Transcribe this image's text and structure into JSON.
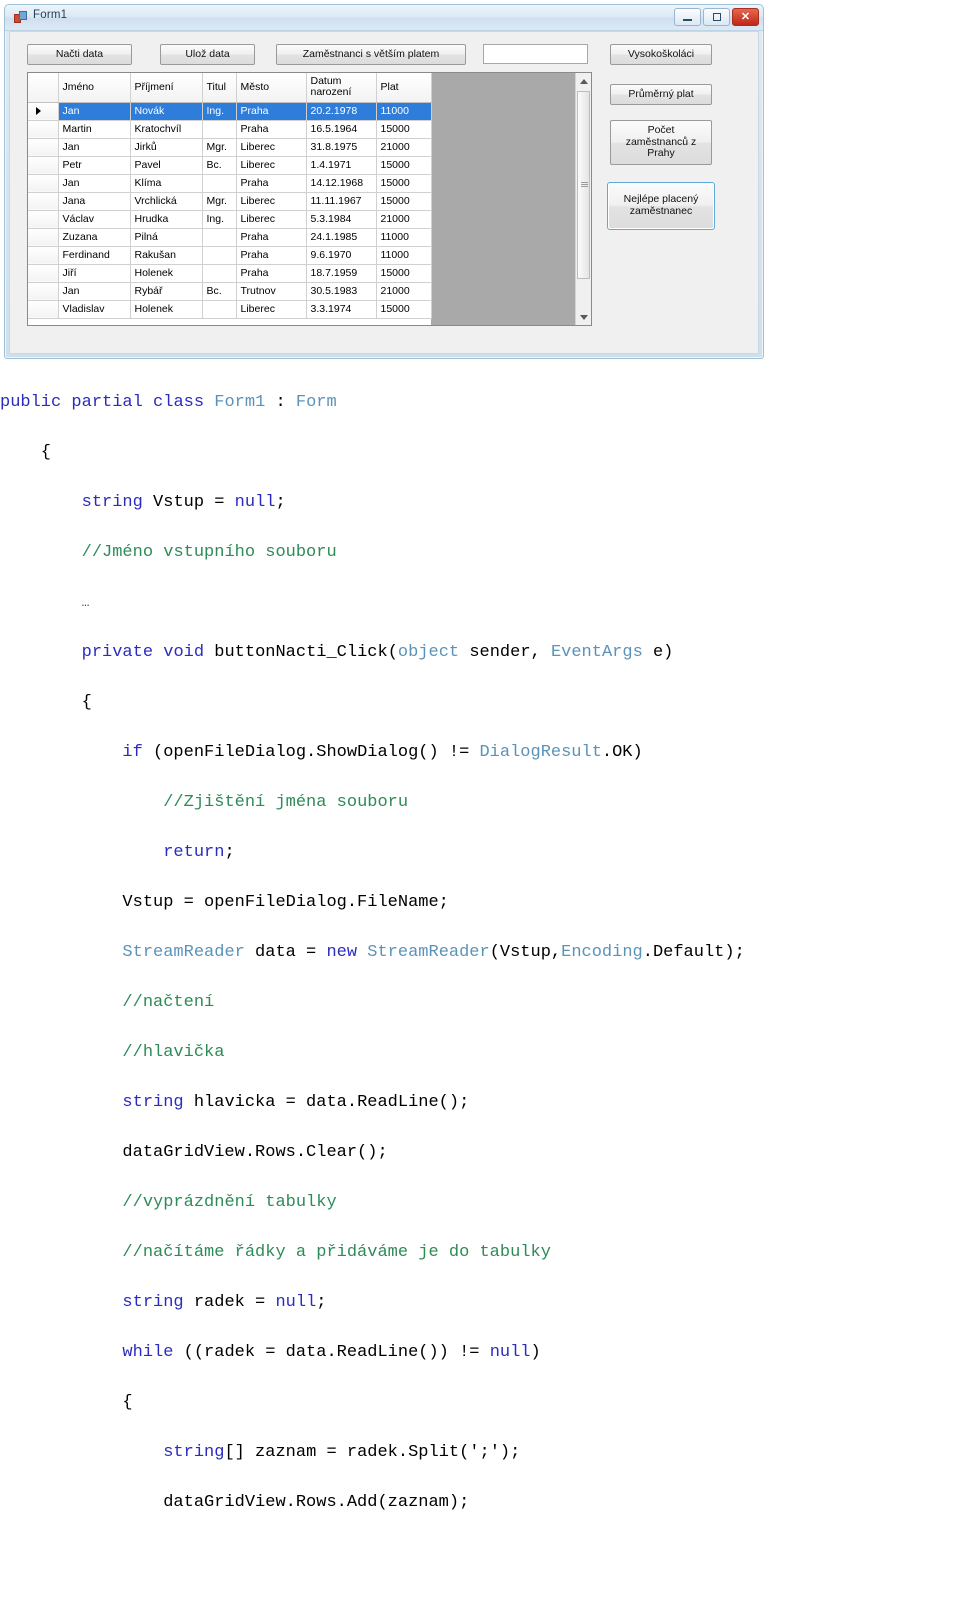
{
  "window": {
    "title": "Form1",
    "icon": "winforms-app-icon",
    "controls": {
      "minimize": "minimize",
      "maximize": "maximize",
      "close": "close"
    }
  },
  "toolbar": {
    "nacti_label": "Načti data",
    "uloz_label": "Ulož data",
    "zamestnanci_label": "Zaměstnanci s větším platem",
    "input_value": "",
    "input_placeholder": ""
  },
  "side_buttons": {
    "vysokoskolaci": "Vysokoškoláci",
    "prumerny_plat": "Průměrný plat",
    "pocet_line1": "Počet",
    "pocet_line2": "zaměstnanců z",
    "pocet_line3": "Prahy",
    "nejlepe_line1": "Nejlépe placený",
    "nejlepe_line2": "zaměstnanec"
  },
  "grid": {
    "columns": [
      "Jméno",
      "Příjmení",
      "Titul",
      "Město",
      "Datum narození",
      "Plat"
    ],
    "column_datum_line1": "Datum",
    "column_datum_line2": "narození",
    "selected_row_index": 0,
    "rows": [
      {
        "jmeno": "Jan",
        "prijmeni": "Novák",
        "titul": "Ing.",
        "mesto": "Praha",
        "datum": "20.2.1978",
        "plat": "11000"
      },
      {
        "jmeno": "Martin",
        "prijmeni": "Kratochvíl",
        "titul": "",
        "mesto": "Praha",
        "datum": "16.5.1964",
        "plat": "15000"
      },
      {
        "jmeno": "Jan",
        "prijmeni": "Jirků",
        "titul": "Mgr.",
        "mesto": "Liberec",
        "datum": "31.8.1975",
        "plat": "21000"
      },
      {
        "jmeno": "Petr",
        "prijmeni": "Pavel",
        "titul": "Bc.",
        "mesto": "Liberec",
        "datum": "1.4.1971",
        "plat": "15000"
      },
      {
        "jmeno": "Jan",
        "prijmeni": "Klíma",
        "titul": "",
        "mesto": "Praha",
        "datum": "14.12.1968",
        "plat": "15000"
      },
      {
        "jmeno": "Jana",
        "prijmeni": "Vrchlická",
        "titul": "Mgr.",
        "mesto": "Liberec",
        "datum": "11.11.1967",
        "plat": "15000"
      },
      {
        "jmeno": "Václav",
        "prijmeni": "Hrudka",
        "titul": "Ing.",
        "mesto": "Liberec",
        "datum": "5.3.1984",
        "plat": "21000"
      },
      {
        "jmeno": "Zuzana",
        "prijmeni": "Pilná",
        "titul": "",
        "mesto": "Praha",
        "datum": "24.1.1985",
        "plat": "11000"
      },
      {
        "jmeno": "Ferdinand",
        "prijmeni": "Rakušan",
        "titul": "",
        "mesto": "Praha",
        "datum": "9.6.1970",
        "plat": "11000"
      },
      {
        "jmeno": "Jiří",
        "prijmeni": "Holenek",
        "titul": "",
        "mesto": "Praha",
        "datum": "18.7.1959",
        "plat": "15000"
      },
      {
        "jmeno": "Jan",
        "prijmeni": "Rybář",
        "titul": "Bc.",
        "mesto": "Trutnov",
        "datum": "30.5.1983",
        "plat": "21000"
      },
      {
        "jmeno": "Vladislav",
        "prijmeni": "Holenek",
        "titul": "",
        "mesto": "Liberec",
        "datum": "3.3.1974",
        "plat": "15000"
      }
    ],
    "scrollbar": {
      "up_arrow": "scroll-up",
      "down_arrow": "scroll-down"
    }
  },
  "code": {
    "lines": [
      "public partial class Form1 : Form",
      "    {",
      "        string Vstup = null;",
      "        //Jméno vstupního souboru",
      "        …",
      "        private void buttonNacti_Click(object sender, EventArgs e)",
      "        {",
      "            if (openFileDialog.ShowDialog() != DialogResult.OK)",
      "                //Zjištění jména souboru",
      "                return;",
      "            Vstup = openFileDialog.FileName;",
      "            StreamReader data = new StreamReader(Vstup,Encoding.Default);",
      "            //načtení",
      "            //hlavička",
      "            string hlavicka = data.ReadLine();",
      "            dataGridView.Rows.Clear();",
      "            //vyprázdnění tabulky",
      "            //načítáme řádky a přidáváme je do tabulky",
      "            string radek = null;",
      "            while ((radek = data.ReadLine()) != null)",
      "            {",
      "                string[] zaznam = radek.Split(';');",
      "                dataGridView.Rows.Add(zaznam);"
    ]
  },
  "colors": {
    "keyword": "#2b2bbf",
    "type": "#5b93b8",
    "comment": "#2e8b57",
    "selection": "#2f7ddb",
    "close_button": "#bf2718",
    "highlight_border": "#5ea9d8"
  }
}
